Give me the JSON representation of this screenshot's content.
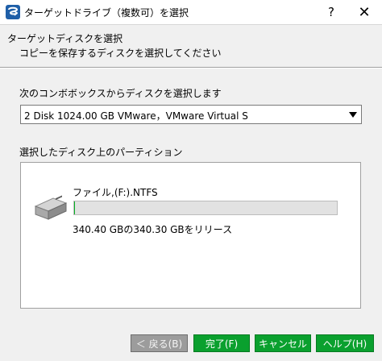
{
  "window": {
    "title": "ターゲットドライブ（複数可）を選択",
    "help_glyph": "?",
    "close_glyph": "✕",
    "icon": "app-logo-icon"
  },
  "header": {
    "title": "ターゲットディスクを選択",
    "subtitle": "コピーを保存するディスクを選択してください"
  },
  "disk_select": {
    "label": "次のコンボボックスからディスクを選択します",
    "selected": "2 Disk 1024.00 GB VMware，VMware Virtual S"
  },
  "partitions": {
    "label": "選択したディスク上のパーティション",
    "items": [
      {
        "icon": "hard-drive-icon",
        "name": "ファイル,(F:).NTFS",
        "used_fraction": 0.0003,
        "release_text": "340.40 GBの340.30 GBをリリース"
      }
    ]
  },
  "buttons": {
    "back": "＜ 戻る(B)",
    "finish": "完了(F)",
    "cancel": "キャンセル",
    "help": "ヘルプ(H)"
  },
  "colors": {
    "accent_green": "#0aa02e",
    "disabled_gray": "#9c9c9c",
    "bar_fill": "#06b025"
  }
}
